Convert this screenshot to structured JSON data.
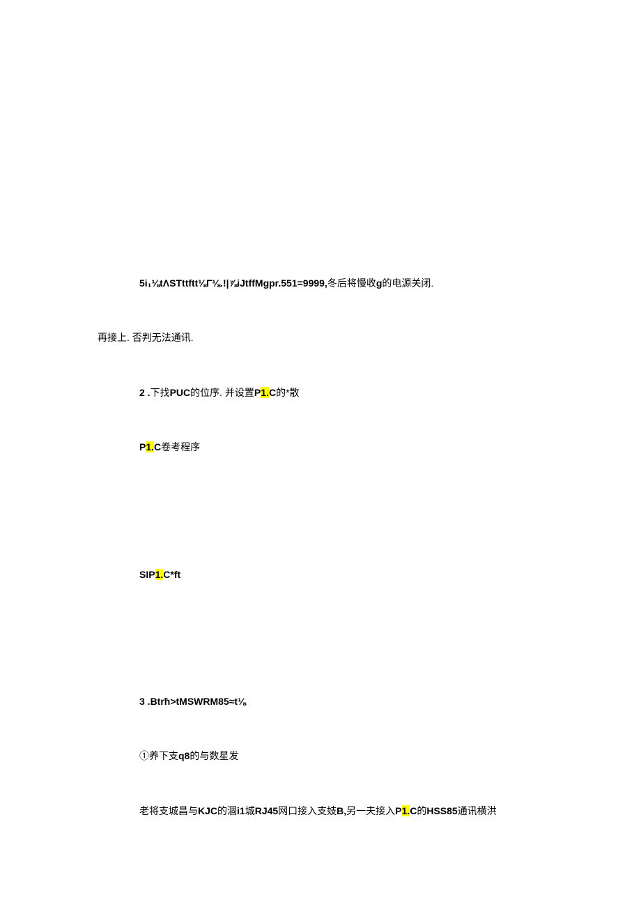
{
  "lines": {
    "l1_a": "5i₁⅛tΛSTttftt⅛Γ⅛.!|⅞iJtffMgpr.551=9999,",
    "l1_b": "冬后将慢收",
    "l1_c": "g",
    "l1_d": "的电源关闭.",
    "l2": "再接上. 否判无法通讯.",
    "l3_a": "2   .",
    "l3_b": "下找",
    "l3_c": "PUC",
    "l3_d": "的位序. 并设置",
    "l3_e": "P",
    "l3_f": "1.",
    "l3_g": "C",
    "l3_h": "的*散",
    "l4_a": "P",
    "l4_b": "1.",
    "l4_c": "C",
    "l4_d": "卷考程序",
    "l5_a": "SIP",
    "l5_b": "1.",
    "l5_c": "C*ft",
    "l6": "3   .Btrħ>tMSWRM85≈t⅛",
    "l7_a": "①养下支",
    "l7_b": "q8",
    "l7_c": "的与数星发",
    "l8_a": "老将支城昌与",
    "l8_b": "KJC",
    "l8_c": "的涸",
    "l8_d": "i1",
    "l8_e": "城",
    "l8_f": "RJ45",
    "l8_g": "网口接入支妓",
    "l8_h": "B,",
    "l8_i": "另一夫接入",
    "l8_j": "P",
    "l8_k": "1.",
    "l8_l": "C",
    "l8_m": "的",
    "l8_n": "HSS85",
    "l8_o": "通讯横洪"
  }
}
